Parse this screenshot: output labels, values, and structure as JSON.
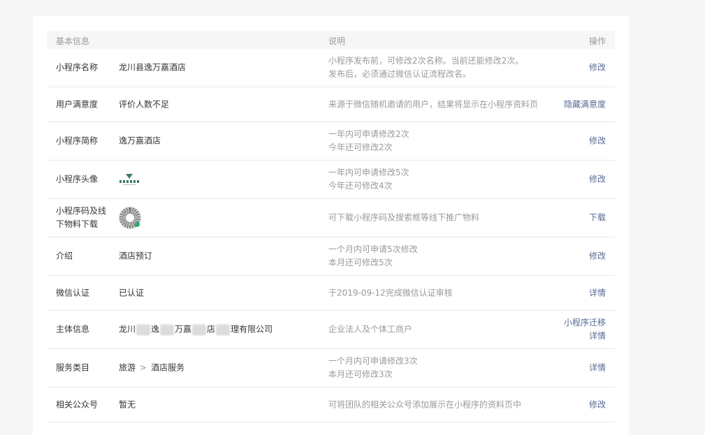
{
  "header": {
    "col_basic": "基本信息",
    "col_desc": "说明",
    "col_ops": "操作"
  },
  "rows": [
    {
      "label": "小程序名称",
      "value": "龙川县逸万嘉酒店",
      "desc": [
        "小程序发布前，可修改2次名称。当前还能修改2次。",
        "发布后，必须通过微信认证流程改名。"
      ],
      "ops": [
        "修改"
      ]
    },
    {
      "label": "用户满意度",
      "value": "评价人数不足",
      "desc": [
        "来源于微信随机邀请的用户，结果将显示在小程序资料页"
      ],
      "ops": [
        "隐藏满意度"
      ]
    },
    {
      "label": "小程序简称",
      "value": "逸万嘉酒店",
      "desc": [
        "一年内可申请修改2次",
        "今年还可修改2次"
      ],
      "ops": [
        "修改"
      ]
    },
    {
      "label": "小程序头像",
      "value": "",
      "desc": [
        "一年内可申请修改5次",
        "今年还可修改4次"
      ],
      "ops": [
        "修改"
      ]
    },
    {
      "label": "小程序码及线下物料下载",
      "value": "",
      "desc": [
        "可下载小程序码及搜索框等线下推广物料"
      ],
      "ops": [
        "下载"
      ]
    },
    {
      "label": "介绍",
      "value": "酒店预订",
      "desc": [
        "一个月内可申请5次修改",
        "本月还可修改5次"
      ],
      "ops": [
        "修改"
      ]
    },
    {
      "label": "微信认证",
      "value": "已认证",
      "desc": [
        "于2019-09-12完成微信认证审核"
      ],
      "ops": [
        "详情"
      ]
    },
    {
      "label": "主体信息",
      "value_parts": [
        "龙川",
        "逸",
        "万嘉",
        "店",
        "理有限公司"
      ],
      "desc": [
        "企业法人及个体工商户"
      ],
      "ops": [
        "小程序迁移",
        "详情"
      ]
    },
    {
      "label": "服务类目",
      "value_parts": [
        "旅游",
        ">",
        "酒店服务"
      ],
      "desc": [
        "一个月内可申请修改3次",
        "本月还可修改3次"
      ],
      "ops": [
        "详情"
      ]
    },
    {
      "label": "相关公众号",
      "value": "暂无",
      "desc": [
        "可将团队的相关公众号添加展示在小程序的资料页中"
      ],
      "ops": [
        "修改"
      ]
    }
  ],
  "colors": {
    "link": "#576b95",
    "muted": "#9a9a9a",
    "text": "#353535",
    "header_bg": "#f6f6f6",
    "divider": "#e7e7eb"
  }
}
